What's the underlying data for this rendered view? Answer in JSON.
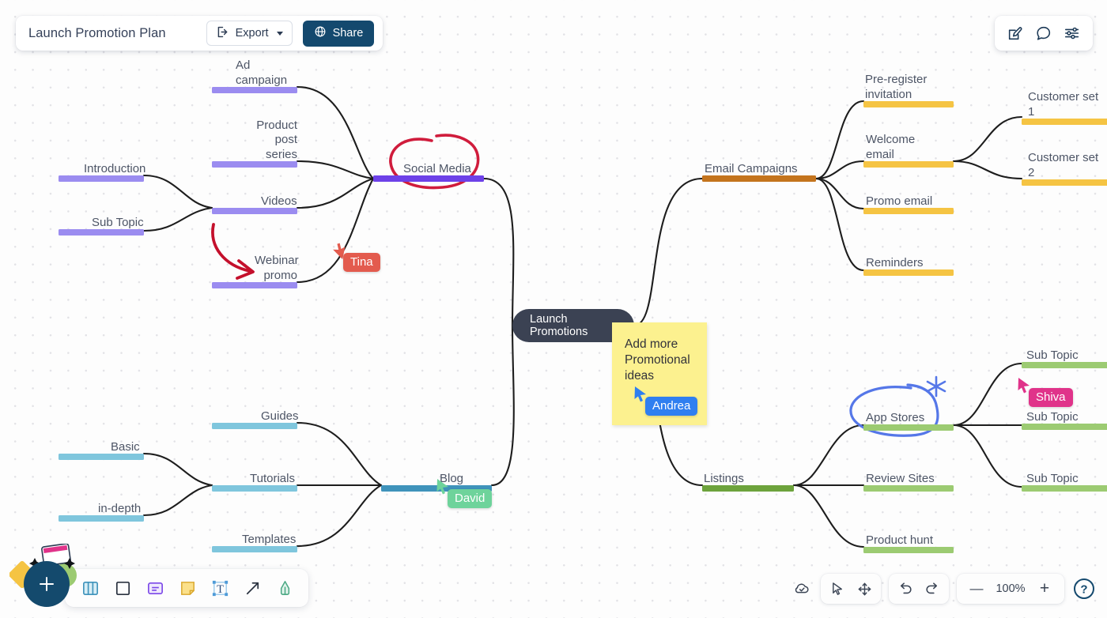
{
  "header": {
    "title": "Launch Promotion Plan",
    "export_label": "Export",
    "export_icon": "export-arrow-icon",
    "share_label": "Share",
    "share_icon": "globe-icon",
    "share_bg": "#14496e"
  },
  "topright": {
    "icons": [
      {
        "name": "edit-icon",
        "label": "Edit"
      },
      {
        "name": "comment-icon",
        "label": "Comments"
      },
      {
        "name": "settings-sliders-icon",
        "label": "Settings"
      }
    ]
  },
  "mindmap": {
    "center": {
      "label": "Launch Promotions",
      "color": "#3b4253"
    },
    "branches": {
      "social_media": {
        "label": "Social Media",
        "color": "#6d41e8",
        "children": [
          {
            "label": "Ad campaign",
            "color": "#9b8cf0"
          },
          {
            "label": "Product post\nseries",
            "color": "#9b8cf0"
          },
          {
            "label": "Videos",
            "color": "#9b8cf0"
          },
          {
            "label": "Webinar\npromo",
            "color": "#9b8cf0"
          }
        ],
        "grandchildren": [
          {
            "label": "Introduction",
            "color": "#9b8cf0"
          },
          {
            "label": "Sub Topic",
            "color": "#9b8cf0"
          }
        ]
      },
      "blog": {
        "label": "Blog",
        "color": "#3f93bb",
        "children": [
          {
            "label": "Guides",
            "color": "#7fc6dd"
          },
          {
            "label": "Tutorials",
            "color": "#7fc6dd"
          },
          {
            "label": "Templates",
            "color": "#7fc6dd"
          }
        ],
        "grandchildren": [
          {
            "label": "Basic",
            "color": "#7fc6dd"
          },
          {
            "label": "in-depth",
            "color": "#7fc6dd"
          }
        ]
      },
      "email_campaigns": {
        "label": "Email Campaigns",
        "color": "#c4741d",
        "children": [
          {
            "label": "Pre-register\ninvitation",
            "color": "#f5c443"
          },
          {
            "label": "Welcome\nemail",
            "color": "#f5c443"
          },
          {
            "label": "Promo email",
            "color": "#f5c443"
          },
          {
            "label": "Reminders",
            "color": "#f5c443"
          }
        ],
        "grandchildren": [
          {
            "label": "Customer set\n1",
            "color": "#f5c443"
          },
          {
            "label": "Customer set\n2",
            "color": "#f5c443"
          }
        ]
      },
      "listings": {
        "label": "Listings",
        "color": "#6da33c",
        "children": [
          {
            "label": "App Stores",
            "color": "#9ccb72"
          },
          {
            "label": "Review Sites",
            "color": "#9ccb72"
          },
          {
            "label": "Product hunt",
            "color": "#9ccb72"
          }
        ],
        "grandchildren": [
          {
            "label": "Sub Topic",
            "color": "#9ccb72"
          },
          {
            "label": "Sub Topic",
            "color": "#9ccb72"
          },
          {
            "label": "Sub Topic",
            "color": "#9ccb72"
          }
        ]
      }
    }
  },
  "sticky_note": {
    "text": "Add more\nPromotional\nideas",
    "color": "#fcf18f"
  },
  "annotations": [
    {
      "name": "red-circle-annotation",
      "target": "Social Media",
      "color": "#d01c3c"
    },
    {
      "name": "red-arrow-annotation",
      "target": "Webinar promo",
      "color": "#c4102c"
    },
    {
      "name": "blue-circle-annotation",
      "target": "App Stores",
      "color": "#5577e8"
    },
    {
      "name": "blue-star-annotation",
      "target": "App Stores",
      "color": "#5577e8"
    }
  ],
  "cursors": [
    {
      "name": "Tina",
      "color": "#e35b4e"
    },
    {
      "name": "Andrea",
      "color": "#2f7ff0"
    },
    {
      "name": "David",
      "color": "#6ed39b"
    },
    {
      "name": "Shiva",
      "color": "#e0338a"
    }
  ],
  "toolbar": {
    "add_label": "+",
    "tools": [
      {
        "name": "template-board-icon",
        "label": "Templates"
      },
      {
        "name": "frame-icon",
        "label": "Frame"
      },
      {
        "name": "card-icon",
        "label": "Card"
      },
      {
        "name": "sticky-note-icon",
        "label": "Sticky note"
      },
      {
        "name": "text-tool-icon",
        "label": "Text"
      },
      {
        "name": "arrow-tool-icon",
        "label": "Arrow"
      },
      {
        "name": "highlighter-pen-icon",
        "label": "Pen"
      }
    ]
  },
  "bottom_controls": {
    "cloud_icon": "cloud-saved-icon",
    "select_icon": "cursor-select-icon",
    "pan_icon": "pan-move-icon",
    "undo_icon": "undo-icon",
    "redo_icon": "redo-icon",
    "zoom_out_label": "—",
    "zoom_level": "100%",
    "zoom_in_label": "+",
    "help_icon": "help-question-icon"
  }
}
